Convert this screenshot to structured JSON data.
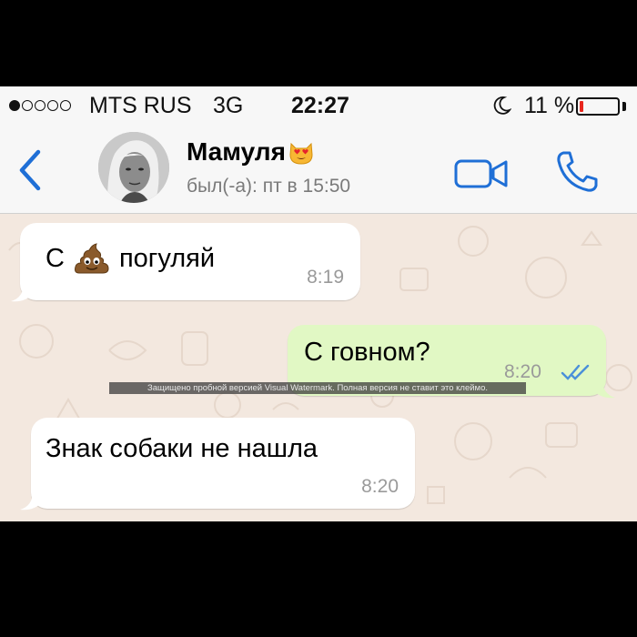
{
  "status_bar": {
    "signal_dots_filled": 1,
    "signal_dots_total": 5,
    "carrier": "MTS RUS",
    "network": "3G",
    "time": "22:27",
    "moon_icon": "moon-icon",
    "battery_text": "11 %",
    "battery_level": 0.11,
    "battery_color": "#e8271e"
  },
  "header": {
    "back_icon": "chevron-left-icon",
    "contact_name": "Мамуля",
    "name_emoji": "heart-eyes-cat-emoji",
    "last_seen": "был(-а): пт в 15:50",
    "video_icon": "video-camera-icon",
    "call_icon": "phone-icon",
    "accent_color": "#1f6fd6"
  },
  "messages": [
    {
      "direction": "incoming",
      "text_before": "С",
      "emoji": "poop-emoji",
      "text_after": "погуляй",
      "time": "8:19"
    },
    {
      "direction": "outgoing",
      "text": "С говном?",
      "time": "8:20",
      "status_icon": "double-check-icon"
    },
    {
      "direction": "incoming",
      "text": "Знак собаки не нашла",
      "time": "8:20"
    }
  ],
  "watermark": "Защищено пробной версией Visual Watermark. Полная версия не ставит это клеймо.",
  "colors": {
    "incoming_bubble": "#ffffff",
    "outgoing_bubble": "#e1f8c4",
    "chat_background": "#f3e8df",
    "tick_color": "#4a90d9"
  }
}
